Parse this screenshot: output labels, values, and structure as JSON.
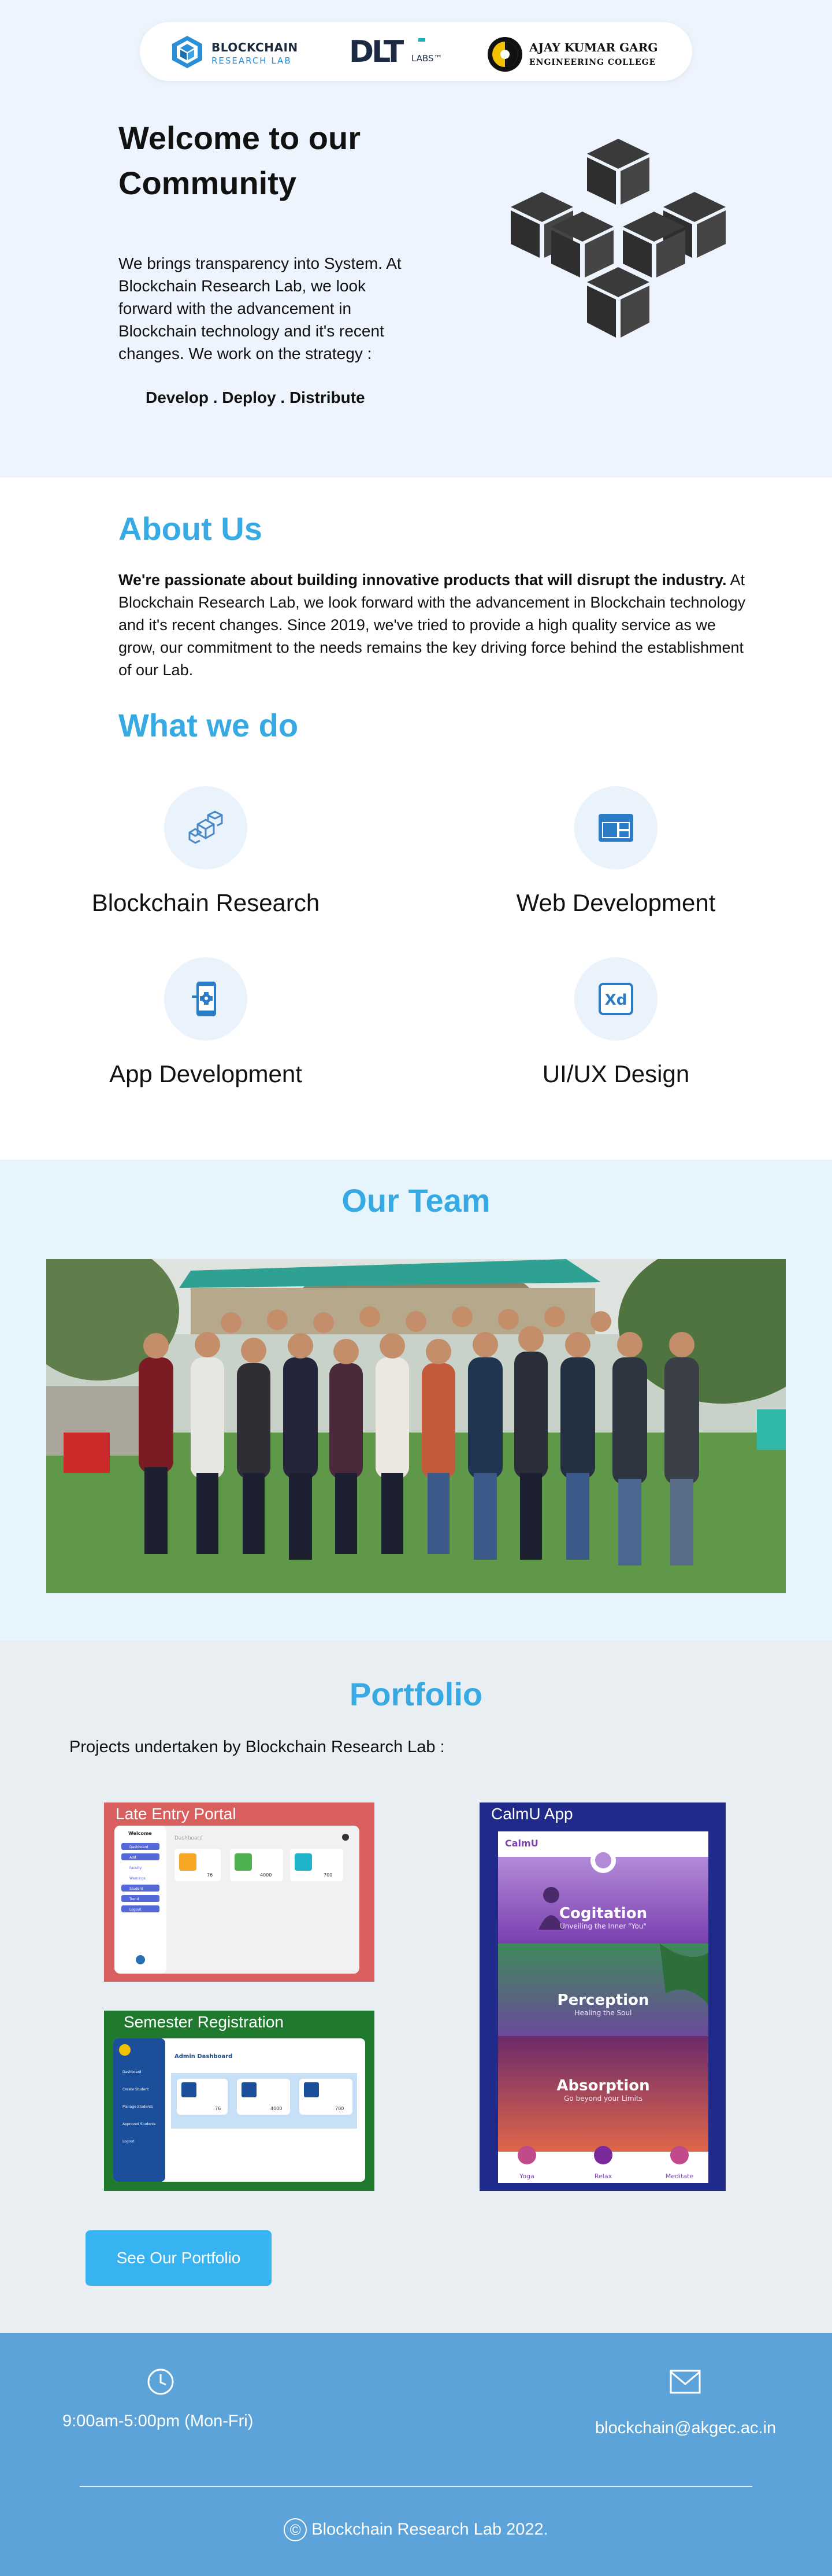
{
  "header": {
    "logo_brl": {
      "line1": "BLOCKCHAIN",
      "line2": "RESEARCH LAB"
    },
    "logo_dlt": {
      "main": "DLT",
      "sub": "LABS™"
    },
    "logo_college": {
      "line1": "AJAY KUMAR GARG",
      "line2": "ENGINEERING COLLEGE"
    }
  },
  "hero": {
    "title": "Welcome to our Community",
    "text": "We brings transparency into System. At Blockchain Research Lab, we look forward with the advancement in Blockchain technology and it's recent changes. We work on the strategy :",
    "tagline": "Develop . Deploy . Distribute"
  },
  "about": {
    "title": "About Us",
    "lead": "We're passionate about building innovative products that will disrupt the industry.",
    "text": "At Blockchain Research Lab, we look forward with the advancement in Blockchain technology and it's recent changes. Since 2019, we've tried to provide a high quality service as we grow, our commitment to the needs remains the key driving force behind the establishment of our Lab."
  },
  "what_we_do": {
    "title": "What we do",
    "services": [
      {
        "label": "Blockchain Research",
        "icon": "cubes-icon"
      },
      {
        "label": "Web Development",
        "icon": "browser-window-icon"
      },
      {
        "label": "App Development",
        "icon": "mobile-gear-icon"
      },
      {
        "label": "UI/UX Design",
        "icon": "xd-icon"
      }
    ]
  },
  "team": {
    "title": "Our Team"
  },
  "portfolio": {
    "title": "Portfolio",
    "subtitle": "Projects undertaken by Blockchain Research Lab :",
    "projects": [
      {
        "title": "Late Entry Portal",
        "color": "#d95f5f"
      },
      {
        "title": "CalmU App",
        "color": "#1f2a8a"
      },
      {
        "title": "Semester Registration",
        "color": "#1f7a2e"
      }
    ],
    "late_entry": {
      "screen_title": "Welcome",
      "dashboard": "Dashboard",
      "menu": [
        "Dashboard",
        "Add",
        "Faculty",
        "Warnings",
        "Student",
        "Trend",
        "Logout"
      ],
      "stats": [
        "76",
        "4000",
        "700"
      ]
    },
    "calmu": {
      "app_name": "CalmU",
      "items": [
        {
          "title": "Cogitation",
          "sub": "Unveiling the Inner \"You\""
        },
        {
          "title": "Perception",
          "sub": "Healing the Soul"
        },
        {
          "title": "Absorption",
          "sub": "Go beyond your Limits"
        }
      ],
      "tabs": [
        "Yoga",
        "Relax",
        "Meditate"
      ]
    },
    "semester": {
      "heading": "Admin Dashboard",
      "menu": [
        "Dashboard",
        "Create Student",
        "Manage Students",
        "Approved Students",
        "Logout"
      ],
      "stats": [
        "76",
        "4000",
        "700"
      ]
    },
    "button_label": "See Our Portfolio"
  },
  "footer": {
    "hours": "9:00am-5:00pm (Mon-Fri)",
    "email": "blockchain@akgec.ac.in",
    "copyright": "Blockchain Research Lab 2022.",
    "copyright_symbol": "©"
  },
  "colors": {
    "accent": "#37a9e3",
    "hero_bg": "#eef4fe",
    "team_bg": "#e6f4fc",
    "portfolio_bg": "#e9eef3",
    "footer_bg": "#5ba3d8",
    "button": "#37b3f2"
  }
}
